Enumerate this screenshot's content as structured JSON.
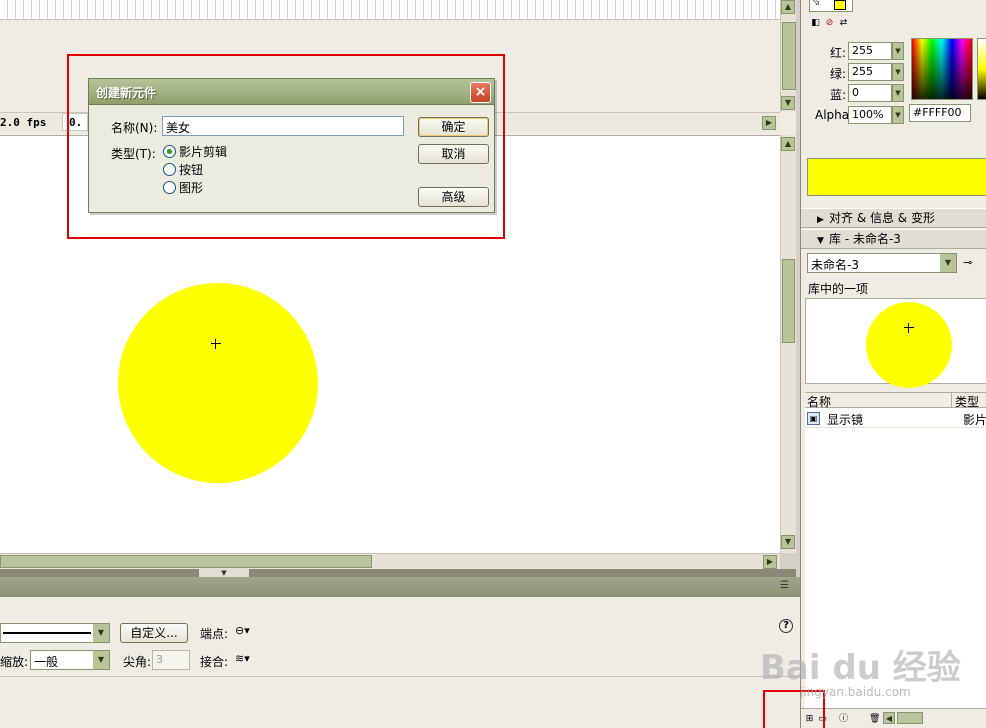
{
  "timeline": {
    "fps": "2.0 fps",
    "time": "0."
  },
  "dialog": {
    "title": "创建新元件",
    "name_label": "名称(N):",
    "name_value": "美女",
    "type_label": "类型(T):",
    "types": [
      {
        "label": "影片剪辑",
        "selected": true
      },
      {
        "label": "按钮",
        "selected": false
      },
      {
        "label": "图形",
        "selected": false
      }
    ],
    "ok_button": "确定",
    "cancel_button": "取消",
    "advanced_button": "高级",
    "close_icon": "×"
  },
  "properties": {
    "custom_button": "自定义...",
    "cap_label": "端点:",
    "scale_label": "缩放:",
    "scale_value": "一般",
    "miter_label": "尖角:",
    "miter_value": "3",
    "join_label": "接合:",
    "help_icon": "?"
  },
  "color_mixer": {
    "red_label": "红:",
    "red_value": "255",
    "green_label": "绿:",
    "green_value": "255",
    "blue_label": "蓝:",
    "blue_value": "0",
    "alpha_label": "Alpha:",
    "alpha_value": "100%",
    "hex_value": "#FFFF00",
    "fill_color": "#FFFF00"
  },
  "panels": {
    "align_panel": "对齐 & 信息 & 变形",
    "library_panel": "库 - 未命名-3"
  },
  "library": {
    "document_select": "未命名-3",
    "item_count": "库中的一项",
    "col_name": "名称",
    "col_type": "类型",
    "items": [
      {
        "name": "显示镜",
        "type": "影片"
      }
    ]
  },
  "watermark": {
    "text": "Bai du 经验",
    "url": "jingyan.baidu.com"
  }
}
